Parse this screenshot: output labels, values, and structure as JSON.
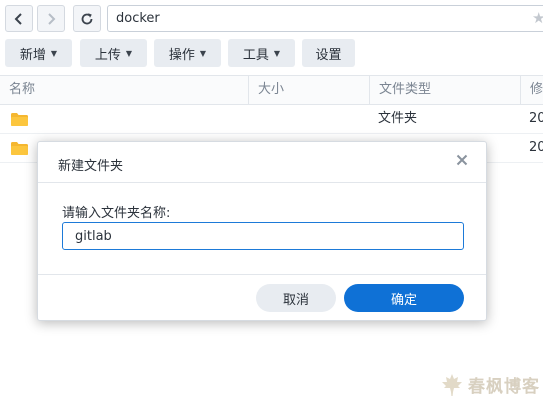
{
  "nav": {
    "back_icon": "chevron-left-icon",
    "forward_icon": "chevron-right-icon",
    "refresh_icon": "refresh-icon",
    "path": "docker",
    "star_icon": "star-icon"
  },
  "toolbar": {
    "new_label": "新增",
    "upload_label": "上传",
    "action_label": "操作",
    "tools_label": "工具",
    "settings_label": "设置"
  },
  "table": {
    "columns": [
      "名称",
      "大小",
      "文件类型",
      "修"
    ],
    "rows": [
      {
        "name": "",
        "size": "",
        "type": "文件夹",
        "modified": "20"
      },
      {
        "name": "",
        "size": "",
        "type": "",
        "modified": "20"
      }
    ]
  },
  "dialog": {
    "title": "新建文件夹",
    "prompt": "请输入文件夹名称:",
    "input_value": "gitlab",
    "cancel_label": "取消",
    "ok_label": "确定"
  },
  "watermark": {
    "text": "春枫博客"
  },
  "colors": {
    "accent": "#0f71d6",
    "folder": "#f5b730",
    "button_bg": "#e8ecf1"
  }
}
